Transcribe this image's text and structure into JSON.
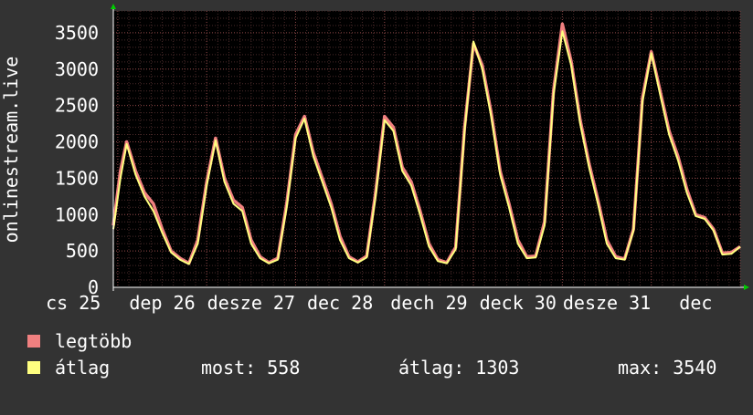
{
  "chart_data": {
    "type": "line",
    "ylabel": "onlinestream.live",
    "ylim": [
      0,
      3800
    ],
    "yticks": [
      0,
      500,
      1000,
      1500,
      2000,
      2500,
      3000,
      3500
    ],
    "grid": true,
    "x_day_labels": [
      {
        "day": 24.5,
        "text": "cs 25"
      },
      {
        "day": 25.5,
        "text": "dep 26"
      },
      {
        "day": 26.5,
        "text": "desze 27"
      },
      {
        "day": 27.5,
        "text": "dec 28"
      },
      {
        "day": 28.5,
        "text": "dech 29"
      },
      {
        "day": 29.5,
        "text": "deck 30"
      },
      {
        "day": 30.5,
        "text": "desze 31"
      },
      {
        "day": 31.5,
        "text": "dec"
      }
    ],
    "x_range": [
      24.95,
      32.0
    ],
    "series": [
      {
        "name": "legtöbb",
        "color": "#f08080",
        "x": [
          24.95,
          25.03,
          25.1,
          25.2,
          25.3,
          25.4,
          25.5,
          25.6,
          25.7,
          25.8,
          25.9,
          26.0,
          26.1,
          26.2,
          26.3,
          26.4,
          26.5,
          26.6,
          26.7,
          26.8,
          26.9,
          27.0,
          27.1,
          27.2,
          27.3,
          27.4,
          27.5,
          27.6,
          27.7,
          27.8,
          27.9,
          28.0,
          28.1,
          28.2,
          28.3,
          28.4,
          28.5,
          28.6,
          28.7,
          28.8,
          28.9,
          29.0,
          29.1,
          29.2,
          29.3,
          29.4,
          29.5,
          29.6,
          29.7,
          29.8,
          29.9,
          30.0,
          30.1,
          30.2,
          30.3,
          30.4,
          30.5,
          30.6,
          30.7,
          30.8,
          30.9,
          31.0,
          31.1,
          31.2,
          31.3,
          31.4,
          31.5,
          31.6,
          31.7,
          31.8,
          31.9,
          32.0
        ],
        "values": [
          850,
          1600,
          2000,
          1600,
          1300,
          1150,
          800,
          500,
          400,
          330,
          650,
          1450,
          2050,
          1500,
          1200,
          1100,
          650,
          420,
          340,
          400,
          1150,
          2100,
          2350,
          1850,
          1500,
          1150,
          700,
          420,
          350,
          430,
          1300,
          2350,
          2200,
          1650,
          1450,
          1050,
          600,
          380,
          340,
          550,
          2200,
          3350,
          3050,
          2400,
          1600,
          1150,
          650,
          420,
          430,
          900,
          2700,
          3620,
          3100,
          2300,
          1700,
          1200,
          650,
          420,
          390,
          800,
          2600,
          3240,
          2700,
          2150,
          1800,
          1350,
          1000,
          960,
          800,
          470,
          480,
          560
        ]
      },
      {
        "name": "átlag",
        "color": "#ffff80",
        "x": [
          24.95,
          25.03,
          25.1,
          25.2,
          25.3,
          25.4,
          25.5,
          25.6,
          25.7,
          25.8,
          25.9,
          26.0,
          26.1,
          26.2,
          26.3,
          26.4,
          26.5,
          26.6,
          26.7,
          26.8,
          26.9,
          27.0,
          27.1,
          27.2,
          27.3,
          27.4,
          27.5,
          27.6,
          27.7,
          27.8,
          27.9,
          28.0,
          28.1,
          28.2,
          28.3,
          28.4,
          28.5,
          28.6,
          28.7,
          28.8,
          28.9,
          29.0,
          29.1,
          29.2,
          29.3,
          29.4,
          29.5,
          29.6,
          29.7,
          29.8,
          29.9,
          30.0,
          30.1,
          30.2,
          30.3,
          30.4,
          30.5,
          30.6,
          30.7,
          30.8,
          30.9,
          31.0,
          31.1,
          31.2,
          31.3,
          31.4,
          31.5,
          31.6,
          31.7,
          31.8,
          31.9,
          32.0
        ],
        "values": [
          800,
          1500,
          1970,
          1550,
          1250,
          1050,
          750,
          480,
          380,
          320,
          600,
          1400,
          2020,
          1450,
          1150,
          1050,
          600,
          400,
          330,
          380,
          1100,
          2050,
          2320,
          1800,
          1450,
          1100,
          650,
          400,
          340,
          410,
          1250,
          2300,
          2150,
          1600,
          1400,
          1000,
          560,
          360,
          330,
          520,
          2150,
          3380,
          3000,
          2350,
          1550,
          1100,
          600,
          400,
          410,
          850,
          2650,
          3520,
          3050,
          2250,
          1650,
          1150,
          600,
          400,
          380,
          780,
          2550,
          3220,
          2650,
          2100,
          1750,
          1300,
          980,
          940,
          780,
          450,
          460,
          558
        ]
      }
    ]
  },
  "legend": [
    {
      "label": "legtöbb",
      "color": "#f08080"
    },
    {
      "label": "átlag",
      "color": "#ffff80"
    }
  ],
  "stats": {
    "now": "most: 558",
    "avg": "átlag: 1303",
    "max": "max: 3540"
  }
}
